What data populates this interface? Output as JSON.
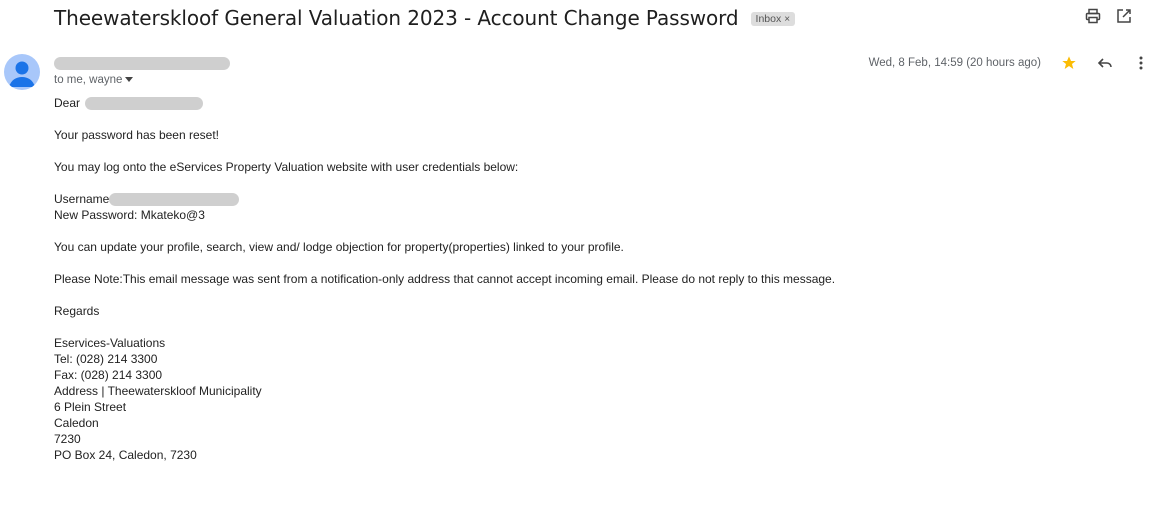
{
  "subject": {
    "title": "Theewaterskloof General Valuation 2023 - Account Change Password",
    "label": "Inbox",
    "label_close": "×"
  },
  "toolbar": {
    "print_icon": "print-icon",
    "open_new_window_icon": "open-in-new-window-icon"
  },
  "message": {
    "recipients": "to me, wayne",
    "recipients_icon": "caret-down-icon",
    "date": "Wed, 8 Feb, 14:59 (20 hours ago)",
    "star_color": "#fbbc04",
    "icons": [
      "star-icon",
      "reply-icon",
      "more-vert-icon"
    ]
  },
  "body": {
    "greeting": "Dear",
    "reset_line": "Your password has been reset!",
    "login_line": "You may log onto the eServices Property Valuation website with user credentials below:",
    "username_label": "Username",
    "new_password_line": "New Password: Mkateko@3",
    "update_line": "You can update your profile, search, view and/ lodge objection for property(properties) linked to your profile.",
    "note_line": "Please Note:This email message was sent from a notification-only address that cannot accept incoming email. Please do not reply to this message.",
    "regards": "Regards",
    "signature": [
      "Eservices-Valuations",
      "Tel: (028) 214 3300",
      "Fax: (028) 214 3300",
      "Address | Theewaterskloof Municipality",
      "6 Plein Street",
      "Caledon",
      "7230",
      "PO Box 24, Caledon, 7230"
    ]
  },
  "colors": {
    "avatar_bg": "#a8c7fa",
    "avatar_fg": "#1a73e8",
    "redaction": "#cfcfcf"
  }
}
